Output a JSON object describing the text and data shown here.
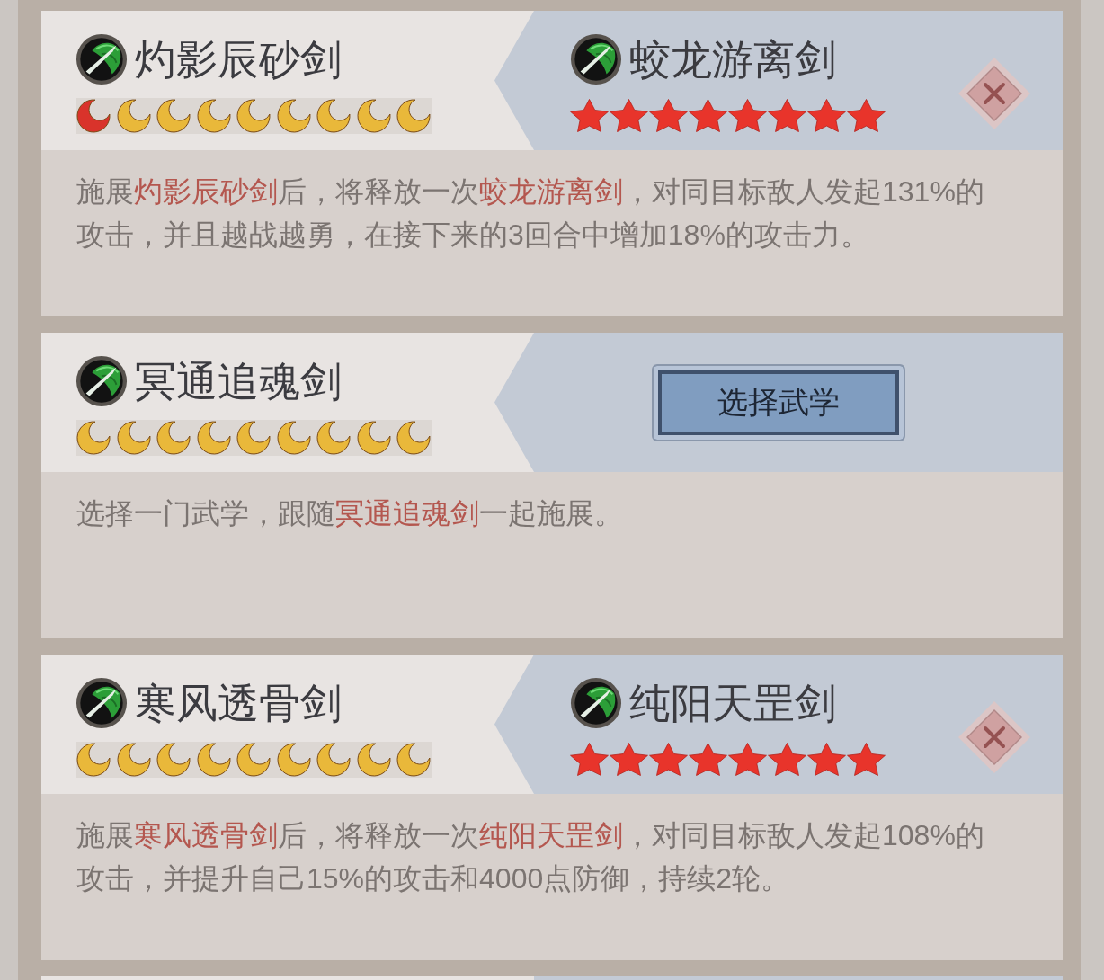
{
  "cards": [
    {
      "skill": {
        "name": "灼影辰砂剑",
        "moons": [
          {
            "color": "#d9332b"
          },
          {
            "color": "#e9b83a"
          },
          {
            "color": "#e9b83a"
          },
          {
            "color": "#e9b83a"
          },
          {
            "color": "#e9b83a"
          },
          {
            "color": "#e9b83a"
          },
          {
            "color": "#e9b83a"
          },
          {
            "color": "#e9b83a"
          },
          {
            "color": "#e9b83a"
          }
        ]
      },
      "pair": {
        "kind": "skill",
        "name": "蛟龙游离剑",
        "stars": 8
      },
      "description": "施展**灼影辰砂剑**后，将释放一次**蛟龙游离剑**，对同目标敌人发起131%的攻击，并且越战越勇，在接下来的3回合中增加18%的攻击力。"
    },
    {
      "skill": {
        "name": "冥通追魂剑",
        "moons": [
          {
            "color": "#e9b83a"
          },
          {
            "color": "#e9b83a"
          },
          {
            "color": "#e9b83a"
          },
          {
            "color": "#e9b83a"
          },
          {
            "color": "#e9b83a"
          },
          {
            "color": "#e9b83a"
          },
          {
            "color": "#e9b83a"
          },
          {
            "color": "#e9b83a"
          },
          {
            "color": "#e9b83a"
          }
        ]
      },
      "pair": {
        "kind": "select",
        "label": "选择武学"
      },
      "description": "选择一门武学，跟随**冥通追魂剑**一起施展。"
    },
    {
      "skill": {
        "name": "寒风透骨剑",
        "moons": [
          {
            "color": "#e9b83a"
          },
          {
            "color": "#e9b83a"
          },
          {
            "color": "#e9b83a"
          },
          {
            "color": "#e9b83a"
          },
          {
            "color": "#e9b83a"
          },
          {
            "color": "#e9b83a"
          },
          {
            "color": "#e9b83a"
          },
          {
            "color": "#e9b83a"
          },
          {
            "color": "#e9b83a"
          }
        ]
      },
      "pair": {
        "kind": "skill",
        "name": "纯阳天罡剑",
        "stars": 8
      },
      "description": "施展**寒风透骨剑**后，将释放一次**纯阳天罡剑**，对同目标敌人发起108%的攻击，并提升自己15%的攻击和4000点防御，持续2轮。"
    }
  ]
}
